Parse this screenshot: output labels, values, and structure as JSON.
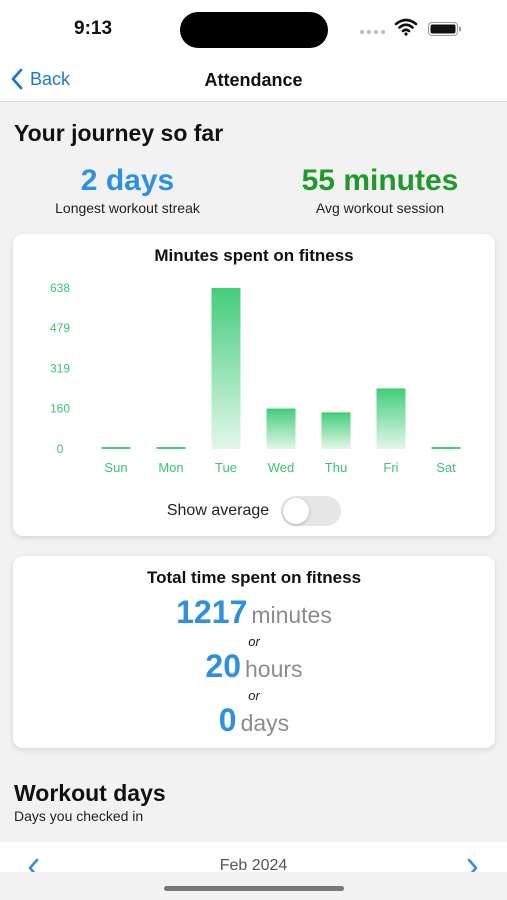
{
  "status_bar": {
    "time": "9:13"
  },
  "nav": {
    "back_label": "Back",
    "title": "Attendance"
  },
  "journey": {
    "title": "Your journey so far",
    "streak_value": "2 days",
    "streak_label": "Longest workout streak",
    "session_value": "55 minutes",
    "session_label": "Avg workout session"
  },
  "chart_data": {
    "type": "bar",
    "title": "Minutes spent on fitness",
    "categories": [
      "Sun",
      "Mon",
      "Tue",
      "Wed",
      "Thu",
      "Fri",
      "Sat"
    ],
    "values": [
      0,
      5,
      638,
      160,
      145,
      240,
      0
    ],
    "yticks": [
      "638",
      "479",
      "319",
      "160",
      "0"
    ],
    "ylim": [
      0,
      638
    ],
    "xlabel": "",
    "ylabel": "",
    "grid": false,
    "colors": {
      "bar_top": "#43cd7b",
      "bar_bottom": "#e3f7ea",
      "axis_text": "#3cc371"
    }
  },
  "chart_controls": {
    "toggle_label": "Show average",
    "toggle_on": false
  },
  "totals": {
    "title": "Total time spent on fitness",
    "minutes_value": "1217",
    "minutes_unit": "minutes",
    "or_1": "or",
    "hours_value": "20",
    "hours_unit": "hours",
    "or_2": "or",
    "days_value": "0",
    "days_unit": "days"
  },
  "workout_days": {
    "title": "Workout days",
    "subtitle": "Days you checked in",
    "month": "Feb 2024"
  },
  "colors": {
    "accent_blue": "#2f8fe0",
    "accent_green": "#1f9a2a",
    "nav_blue": "#1a78d6"
  }
}
